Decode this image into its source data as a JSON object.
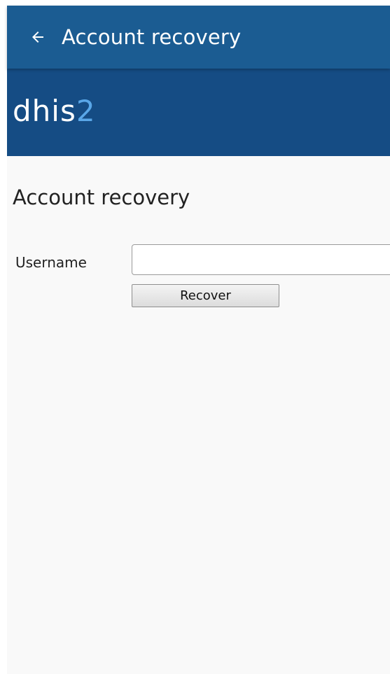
{
  "app_bar": {
    "back_icon": "arrow-left-icon",
    "title": "Account recovery",
    "background_color": "#1b5c92"
  },
  "banner": {
    "logo_text": "dhis",
    "logo_number": "2",
    "background_color": "#154c84",
    "accent_color": "#5aa7e8"
  },
  "form": {
    "heading": "Account recovery",
    "username_label": "Username",
    "username_value": "",
    "submit_label": "Recover"
  }
}
